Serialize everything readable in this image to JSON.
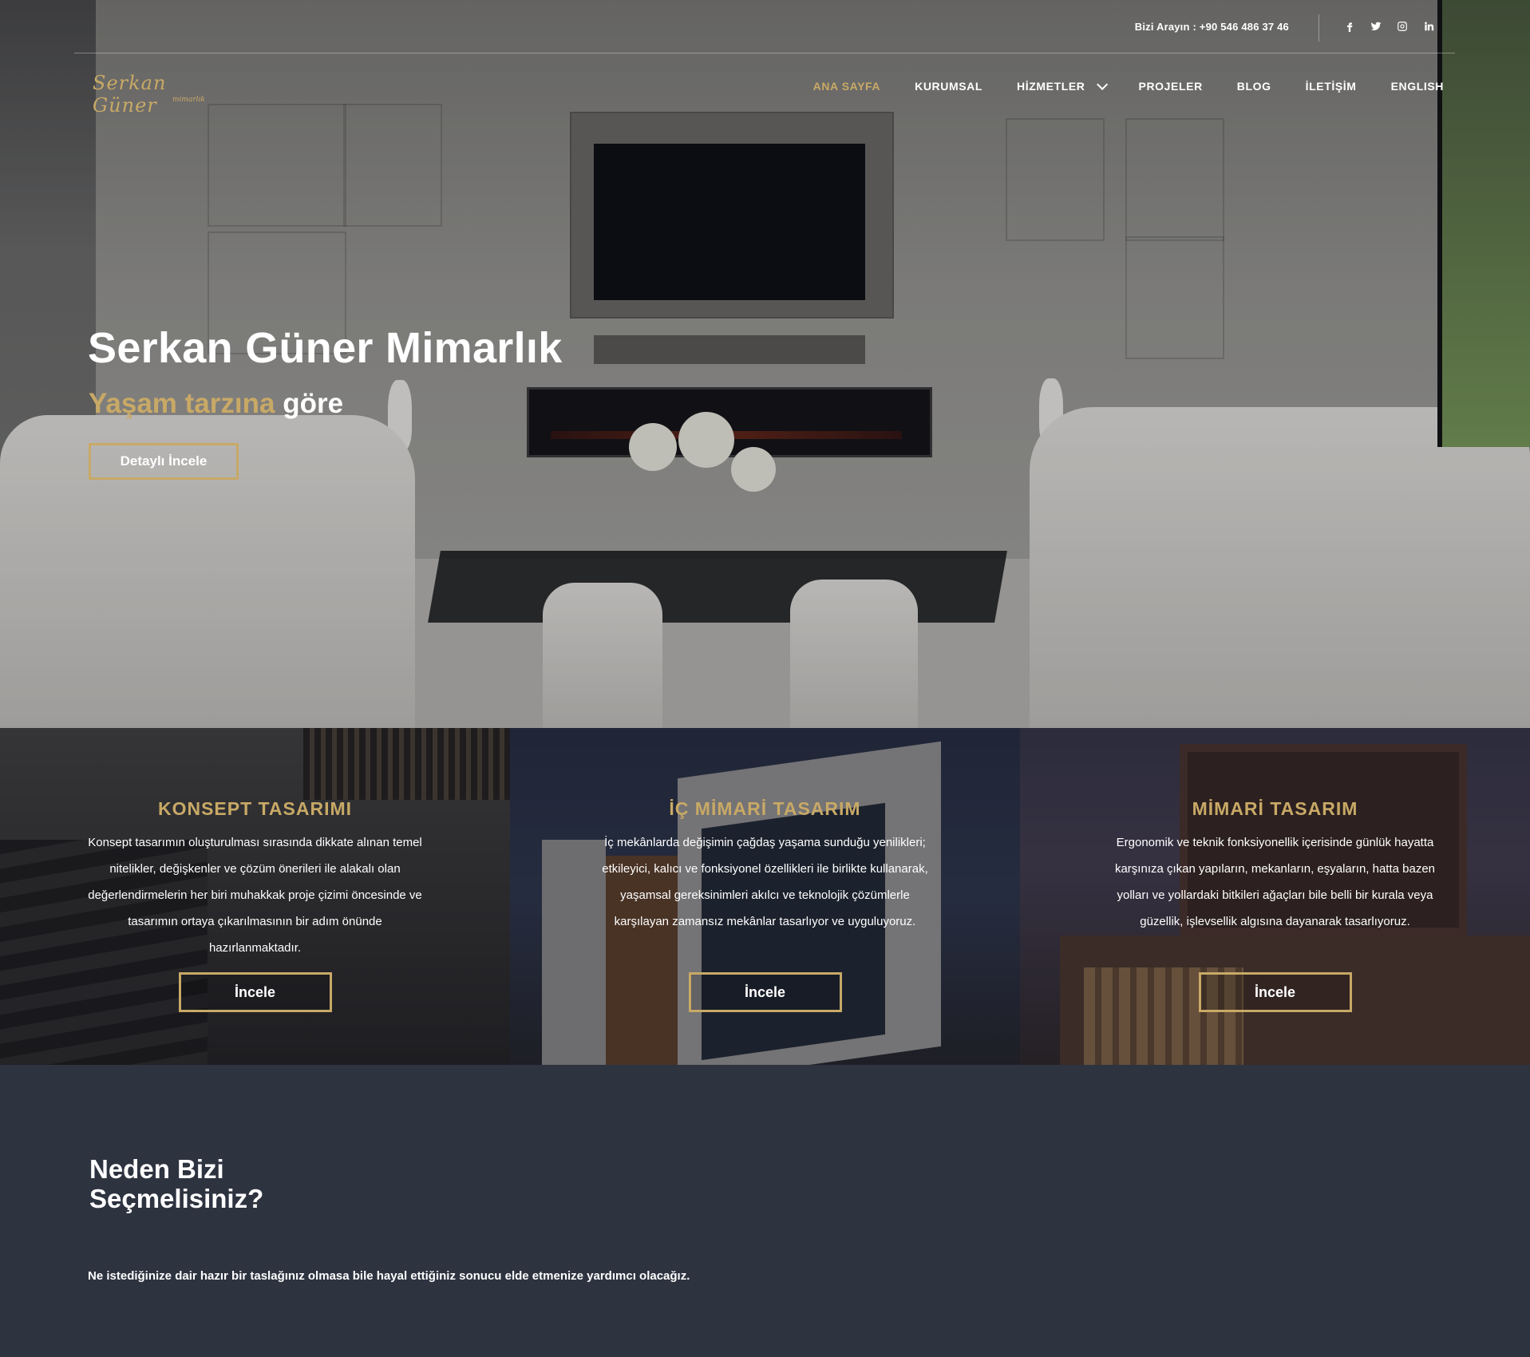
{
  "topbar": {
    "phone": "Bizi Arayın : +90 546 486 37 46",
    "social": [
      "facebook-icon",
      "twitter-icon",
      "instagram-icon",
      "linkedin-icon"
    ]
  },
  "logo": {
    "script": "Serkan Güner",
    "sub": "mimarlık"
  },
  "nav": {
    "items": [
      {
        "label": "ANA SAYFA",
        "active": true
      },
      {
        "label": "KURUMSAL"
      },
      {
        "label": "HİZMETLER",
        "dropdown": true
      },
      {
        "label": "PROJELER"
      },
      {
        "label": "BLOG"
      },
      {
        "label": "İLETİŞİM"
      },
      {
        "label": "ENGLISH"
      }
    ]
  },
  "hero": {
    "title": "Serkan Güner Mimarlık",
    "subtitle_gold": "Yaşam tarzına",
    "subtitle_white": "göre",
    "button": "Detaylı İncele"
  },
  "cards": [
    {
      "title": "KONSEPT TASARIMI",
      "text": "Konsept tasarımın oluşturulması sırasında dikkate alınan temel nitelikler, değişkenler ve çözüm önerileri ile alakalı olan değerlendirmelerin her biri muhakkak proje çizimi öncesinde ve tasarımın ortaya çıkarılmasının bir adım önünde hazırlanmaktadır.",
      "button": "İncele"
    },
    {
      "title": "İÇ MİMARİ TASARIM",
      "text": "İç mekânlarda değişimin çağdaş yaşama sunduğu yenilikleri; etkileyici, kalıcı ve fonksiyonel özellikleri ile birlikte kullanarak, yaşamsal gereksinimleri akılcı ve teknolojik çözümlerle karşılayan zamansız mekânlar tasarlıyor ve uyguluyoruz.",
      "button": "İncele"
    },
    {
      "title": "MİMARİ TASARIM",
      "text": "Ergonomik ve teknik fonksiyonellik içerisinde günlük hayatta karşınıza çıkan yapıların, mekanların, eşyaların, hatta bazen yolları ve yollardaki bitkileri ağaçları bile belli bir kurala veya güzellik, işlevsellik algısına dayanarak tasarlıyoruz.",
      "button": "İncele"
    }
  ],
  "why": {
    "title": "Neden Bizi Seçmelisiniz?",
    "text": "Ne istediğinize dair hazır bir taslağınız olmasa bile hayal ettiğiniz sonucu elde etmenize yardımcı olacağız."
  },
  "colors": {
    "accent": "#c8a966",
    "section_bg": "#2e3340"
  }
}
